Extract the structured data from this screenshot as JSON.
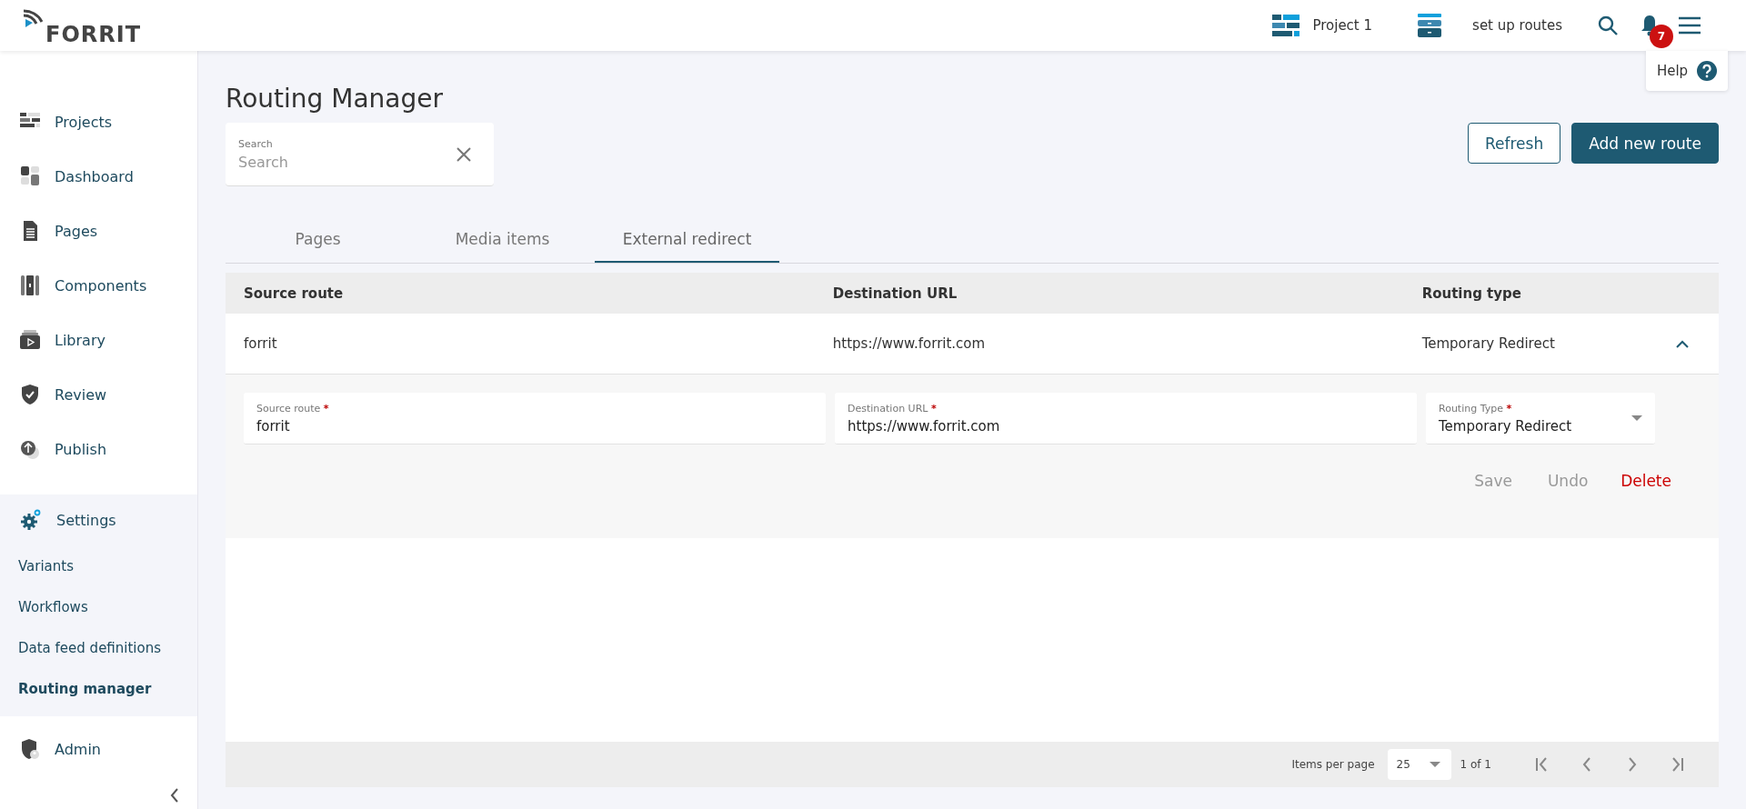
{
  "logo": {
    "text": "FORRIT"
  },
  "header": {
    "project": "Project 1",
    "task": "set up routes",
    "notifications": "7",
    "help": "Help"
  },
  "sidebar": {
    "items": [
      {
        "label": "Projects"
      },
      {
        "label": "Dashboard"
      },
      {
        "label": "Pages"
      },
      {
        "label": "Components"
      },
      {
        "label": "Library"
      },
      {
        "label": "Review"
      },
      {
        "label": "Publish"
      }
    ],
    "settings": {
      "label": "Settings",
      "children": [
        {
          "label": "Variants",
          "selected": false
        },
        {
          "label": "Workflows",
          "selected": false
        },
        {
          "label": "Data feed definitions",
          "selected": false
        },
        {
          "label": "Routing manager",
          "selected": true
        }
      ]
    },
    "admin": "Admin"
  },
  "page": {
    "title": "Routing Manager",
    "search": {
      "label": "Search",
      "placeholder": "Search"
    },
    "buttons": [
      {
        "label": "Refresh",
        "kind": "outline"
      },
      {
        "label": "Add new route",
        "kind": "primary"
      }
    ],
    "tabs": [
      {
        "label": "Pages",
        "selected": false
      },
      {
        "label": "Media items",
        "selected": false
      },
      {
        "label": "External redirect",
        "selected": true
      }
    ],
    "table": {
      "columns": [
        "Source route",
        "Destination URL",
        "Routing type"
      ],
      "rows": [
        {
          "cells": [
            "forrit",
            "https://www.forrit.com",
            "Temporary Redirect"
          ],
          "expanded": true,
          "form": {
            "fields": [
              {
                "label": "Source route",
                "required_mark": "*",
                "value": "forrit",
                "kind": "text"
              },
              {
                "label": "Destination URL",
                "required_mark": "*",
                "value": "https://www.forrit.com",
                "kind": "text"
              },
              {
                "label": "Routing Type",
                "required_mark": "*",
                "value": "Temporary Redirect",
                "kind": "select"
              }
            ],
            "actions": [
              {
                "label": "Save",
                "disabled": true,
                "kind": "normal"
              },
              {
                "label": "Undo",
                "disabled": true,
                "kind": "normal"
              },
              {
                "label": "Delete",
                "disabled": false,
                "kind": "danger"
              }
            ]
          }
        }
      ]
    },
    "pagination": {
      "label": "Items per page",
      "per_page": "25",
      "range": "1 of 1"
    }
  }
}
